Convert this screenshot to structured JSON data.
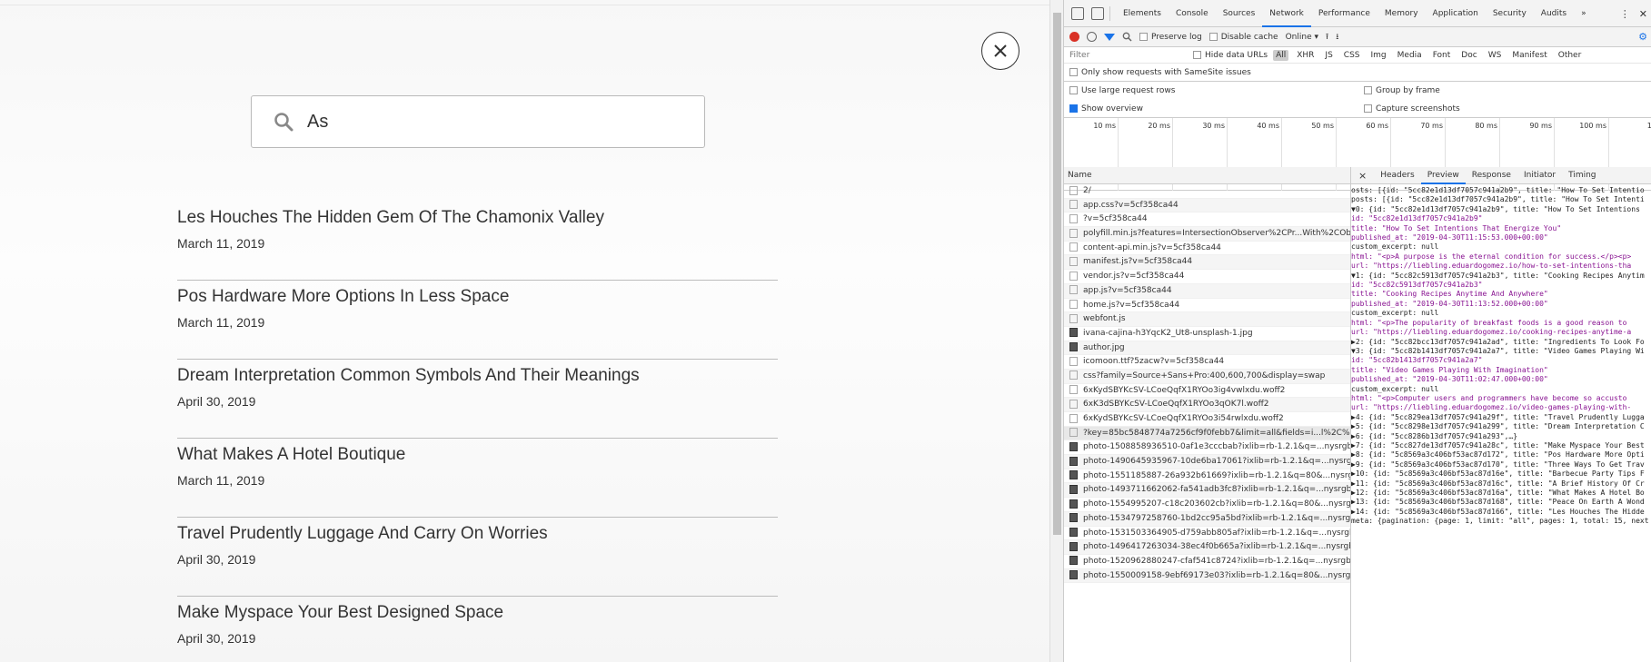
{
  "search": {
    "value": "As"
  },
  "results": [
    {
      "title": "Les Houches The Hidden Gem Of The Chamonix Valley",
      "date": "March 11, 2019"
    },
    {
      "title": "Pos Hardware More Options In Less Space",
      "date": "March 11, 2019"
    },
    {
      "title": "Dream Interpretation Common Symbols And Their Meanings",
      "date": "April 30, 2019"
    },
    {
      "title": "What Makes A Hotel Boutique",
      "date": "March 11, 2019"
    },
    {
      "title": "Travel Prudently Luggage And Carry On Worries",
      "date": "April 30, 2019"
    },
    {
      "title": "Make Myspace Your Best Designed Space",
      "date": "April 30, 2019"
    }
  ],
  "devtools": {
    "tabs": [
      "Elements",
      "Console",
      "Sources",
      "Network",
      "Performance",
      "Memory",
      "Application",
      "Security",
      "Audits"
    ],
    "more": "»",
    "toolbar": {
      "preserve_log": "Preserve log",
      "disable_cache": "Disable cache",
      "throttle": "Online"
    },
    "filter": {
      "placeholder": "Filter",
      "hide_data_urls": "Hide data URLs",
      "types": [
        "All",
        "XHR",
        "JS",
        "CSS",
        "Img",
        "Media",
        "Font",
        "Doc",
        "WS",
        "Manifest",
        "Other"
      ]
    },
    "samesite": "Only show requests with SameSite issues",
    "large_rows": "Use large request rows",
    "group_by_frame": "Group by frame",
    "show_overview": "Show overview",
    "capture_screenshots": "Capture screenshots",
    "timeline_ticks": [
      "10 ms",
      "20 ms",
      "30 ms",
      "40 ms",
      "50 ms",
      "60 ms",
      "70 ms",
      "80 ms",
      "90 ms",
      "100 ms",
      "110"
    ],
    "name_header": "Name",
    "requests": [
      "2/",
      "app.css?v=5cf358ca44",
      "?v=5cf358ca44",
      "polyfill.min.js?features=IntersectionObserver%2CPr...With%2CObject.as...",
      "content-api.min.js?v=5cf358ca44",
      "manifest.js?v=5cf358ca44",
      "vendor.js?v=5cf358ca44",
      "app.js?v=5cf358ca44",
      "home.js?v=5cf358ca44",
      "webfont.js",
      "ivana-cajina-h3YqcK2_Ut8-unsplash-1.jpg",
      "author.jpg",
      "icomoon.ttf?5zacw?v=5cf358ca44",
      "css?family=Source+Sans+Pro:400,600,700&display=swap",
      "6xKydSBYKcSV-LCoeQqfX1RYOo3ig4vwlxdu.woff2",
      "6xK3dSBYKcSV-LCoeQqfX1RYOo3qOK7l.woff2",
      "6xKydSBYKcSV-LCoeQqfX1RYOo3i54rwlxdu.woff2",
      "?key=85bc5848774a7256cf9f0febb7&limit=all&fields=i...l%2C%20publi...",
      "photo-1508858936510-0af1e3cccbab?ixlib=rb-1.2.1&q=...nysrgb&w=2...",
      "photo-1490645935967-10de6ba17061?ixlib=rb-1.2.1&q=...nysrgb&w=...",
      "photo-1551185887-26a932b61669?ixlib=rb-1.2.1&q=80&...nysrgb&w=...",
      "photo-1493711662062-fa541adb3fc8?ixlib=rb-1.2.1&q=...nysrgb&w=...",
      "photo-1554995207-c18c203602cb?ixlib=rb-1.2.1&q=80&...nysrgb&w=...",
      "photo-1534797258760-1bd2cc95a5bd?ixlib=rb-1.2.1&q=...nysrgb&w=...",
      "photo-1531503364905-d759abb805af?ixlib=rb-1.2.1&q=...nysrgb&w=2...",
      "photo-1496417263034-38ec4f0b665a?ixlib=rb-1.2.1&q=...nysrgb&w=...",
      "photo-1520962880247-cfaf541c8724?ixlib=rb-1.2.1&q=...nysrgb&w=2...",
      "photo-1550009158-9ebf69173e03?ixlib=rb-1.2.1&q=80&...nysrgb&w=..."
    ],
    "preview_tabs": [
      "Headers",
      "Preview",
      "Response",
      "Initiator",
      "Timing"
    ],
    "preview_close": "×",
    "preview_lines": [
      "osts: [{id: \"5cc82e1d13df7057c941a2b9\", title: \"How To Set Intentio",
      "posts: [{id: \"5cc82e1d13df7057c941a2b9\", title: \"How To Set Intenti",
      "▼0: {id: \"5cc82e1d13df7057c941a2b9\", title: \"How To Set Intentions",
      "    id: \"5cc82e1d13df7057c941a2b9\"",
      "    title: \"How To Set Intentions That Energize You\"",
      "    published_at: \"2019-04-30T11:15:53.000+00:00\"",
      "    custom_excerpt: null",
      "    html: \"<p>A purpose is the eternal condition for success.</p><p>",
      "    url: \"https://liebling.eduardogomez.io/how-to-set-intentions-tha",
      "▼1: {id: \"5cc82c5913df7057c941a2b3\", title: \"Cooking Recipes Anytim",
      "    id: \"5cc82c5913df7057c941a2b3\"",
      "    title: \"Cooking Recipes Anytime And Anywhere\"",
      "    published_at: \"2019-04-30T11:13:52.000+00:00\"",
      "    custom_excerpt: null",
      "    html: \"<p>The popularity of breakfast foods is a good reason to",
      "    url: \"https://liebling.eduardogomez.io/cooking-recipes-anytime-a",
      "▶2: {id: \"5cc82bcc13df7057c941a2ad\", title: \"Ingredients To Look Fo",
      "▼3: {id: \"5cc82b1413df7057c941a2a7\", title: \"Video Games Playing Wi",
      "    id: \"5cc82b1413df7057c941a2a7\"",
      "    title: \"Video Games Playing With Imagination\"",
      "    published_at: \"2019-04-30T11:02:47.000+00:00\"",
      "    custom_excerpt: null",
      "    html: \"<p>Computer users and programmers have become so accusto",
      "    url: \"https://liebling.eduardogomez.io/video-games-playing-with-",
      "▶4: {id: \"5cc829ea13df7057c941a29f\", title: \"Travel Prudently Lugga",
      "▶5: {id: \"5cc8298e13df7057c941a299\", title: \"Dream Interpretation C",
      "▶6: {id: \"5cc8286b13df7057c941a293\",…}",
      "▶7: {id: \"5cc827de13df7057c941a28c\", title: \"Make Myspace Your Best",
      "▶8: {id: \"5c8569a3c406bf53ac87d172\", title: \"Pos Hardware More Opti",
      "▶9: {id: \"5c8569a3c406bf53ac87d170\", title: \"Three Ways To Get Trav",
      "▶10: {id: \"5c8569a3c406bf53ac87d16e\", title: \"Barbecue Party Tips F",
      "▶11: {id: \"5c8569a3c406bf53ac87d16c\", title: \"A Brief History Of Cr",
      "▶12: {id: \"5c8569a3c406bf53ac87d16a\", title: \"What Makes A Hotel Bo",
      "▶13: {id: \"5c8569a3c406bf53ac87d168\", title: \"Peace On Earth A Wond",
      "▶14: {id: \"5c8569a3c406bf53ac87d166\", title: \"Les Houches The Hidde",
      "meta: {pagination: {page: 1, limit: \"all\", pages: 1, total: 15, next"
    ]
  }
}
